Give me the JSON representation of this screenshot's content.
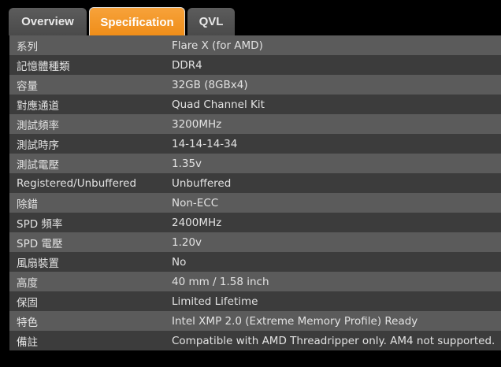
{
  "tabs": [
    {
      "label": "Overview",
      "active": false
    },
    {
      "label": "Specification",
      "active": true
    },
    {
      "label": "QVL",
      "active": false
    }
  ],
  "colors": {
    "accent": "#f39a2a",
    "row_light": "#5b5b5b",
    "row_dark": "#3c3c3c",
    "annotation_arrow": "#f7f2a8"
  },
  "specs": [
    {
      "label": "系列",
      "value": "Flare X (for AMD)"
    },
    {
      "label": "記憶體種類",
      "value": "DDR4"
    },
    {
      "label": "容量",
      "value": "32GB (8GBx4)"
    },
    {
      "label": "對應通道",
      "value": "Quad Channel Kit"
    },
    {
      "label": "測試頻率",
      "value": "3200MHz"
    },
    {
      "label": "測試時序",
      "value": "14-14-14-34"
    },
    {
      "label": "測試電壓",
      "value": "1.35v"
    },
    {
      "label": "Registered/Unbuffered",
      "value": "Unbuffered"
    },
    {
      "label": "除錯",
      "value": "Non-ECC"
    },
    {
      "label": "SPD 頻率",
      "value": "2400MHz"
    },
    {
      "label": "SPD 電壓",
      "value": "1.20v"
    },
    {
      "label": "風扇裝置",
      "value": "No"
    },
    {
      "label": "高度",
      "value": "40 mm / 1.58 inch"
    },
    {
      "label": "保固",
      "value": "Limited Lifetime"
    },
    {
      "label": "特色",
      "value": "Intel XMP 2.0 (Extreme Memory Profile) Ready"
    },
    {
      "label": "備註",
      "value": "Compatible with AMD Threadripper only. AM4 not supported."
    }
  ]
}
